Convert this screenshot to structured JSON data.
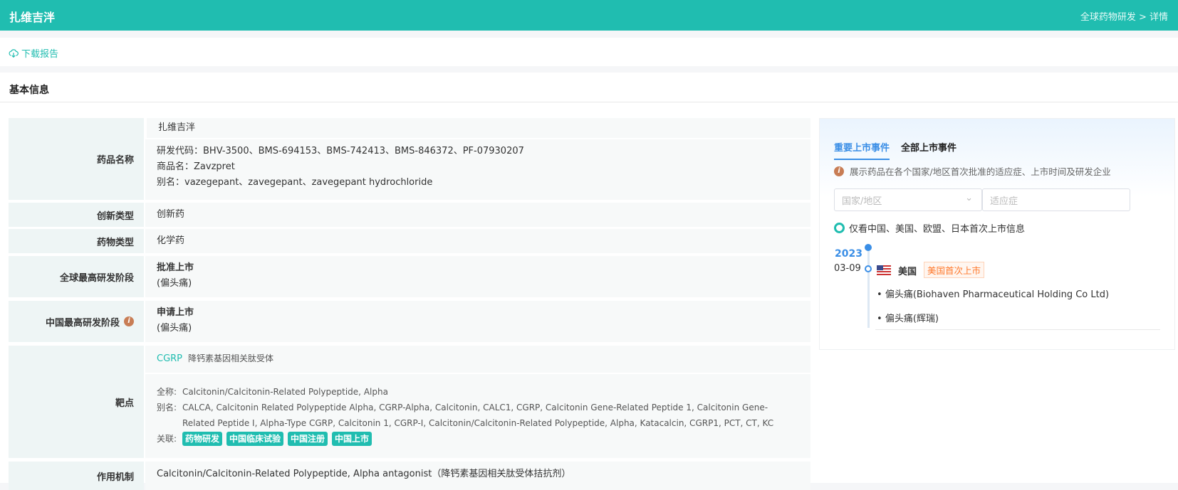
{
  "header": {
    "title": "扎维吉泮",
    "breadcrumb": "全球药物研发 > 详情"
  },
  "toolbar": {
    "download_label": "下载报告"
  },
  "section_title": "基本信息",
  "rows": {
    "name": {
      "label": "药品名称",
      "cn_name": "扎维吉泮",
      "codes": "研发代码：BHV-3500、BMS-694153、BMS-742413、BMS-846372、PF-07930207",
      "trade": "商品名：Zavzpret",
      "alias": "别名：vazegepant、zavegepant、zavegepant hydrochloride"
    },
    "innovation": {
      "label": "创新类型",
      "value": "创新药"
    },
    "drug_type": {
      "label": "药物类型",
      "value": "化学药"
    },
    "global_stage": {
      "label": "全球最高研发阶段",
      "value": "批准上市",
      "sub": "(偏头痛)"
    },
    "china_stage": {
      "label": "中国最高研发阶段",
      "value": "申请上市",
      "sub": "(偏头痛)"
    },
    "target": {
      "label": "靶点",
      "code": "CGRP",
      "cn": "降钙素基因相关肽受体",
      "full_label": "全称:",
      "full": "Calcitonin/Calcitonin-Related Polypeptide, Alpha",
      "alias_label": "别名:",
      "alias": "CALCA, Calcitonin Related Polypeptide Alpha, CGRP-Alpha, Calcitonin, CALC1, CGRP, Calcitonin Gene-Related Peptide 1, Calcitonin Gene-Related Peptide I, Alpha-Type CGRP, Calcitonin 1, CGRP-I, Calcitonin/Calcitonin-Related Polypeptide, Alpha, Katacalcin, CGRP1, PCT, CT, KC",
      "related_label": "关联:",
      "tags": [
        "药物研发",
        "中国临床试验",
        "中国注册",
        "中国上市"
      ]
    },
    "mechanism": {
      "label": "作用机制",
      "value": "Calcitonin/Calcitonin-Related Polypeptide, Alpha antagonist（降钙素基因相关肽受体拮抗剂）"
    }
  },
  "panel": {
    "tabs": [
      "重要上市事件",
      "全部上市事件"
    ],
    "note": "展示药品在各个国家/地区首次批准的适应症、上市时间及研发企业",
    "country_placeholder": "国家/地区",
    "indication_placeholder": "适应症",
    "radio_label": "仅看中国、美国、欧盟、日本首次上市信息",
    "year": "2023",
    "date": "03-09",
    "country": "美国",
    "badge": "美国首次上市",
    "items": [
      "偏头痛(Biohaven Pharmaceutical Holding Co Ltd)",
      "偏头痛(辉瑞)"
    ]
  },
  "colors": {
    "accent": "#20bdb0",
    "blue": "#3a8ee6",
    "badge": "#ff7a2e"
  }
}
